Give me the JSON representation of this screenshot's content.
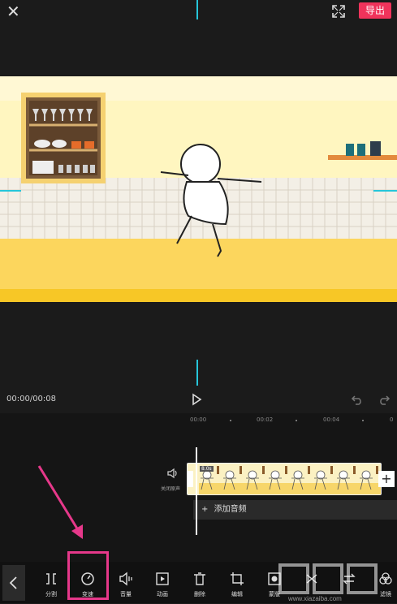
{
  "header": {
    "close_icon": "close-icon",
    "fullscreen_icon": "fullscreen-icon",
    "export_label": "导出"
  },
  "player": {
    "timecode": "00:00/00:08"
  },
  "timeline": {
    "ticks": [
      "00:00",
      "00:02",
      "00:04"
    ],
    "mute_label": "关闭原声",
    "clip_duration": "8.0s",
    "add_clip": "+",
    "add_audio_label": "添加音频"
  },
  "toolbar": {
    "items": [
      {
        "label": "分割",
        "icon": "split-icon"
      },
      {
        "label": "变速",
        "icon": "speed-icon"
      },
      {
        "label": "音量",
        "icon": "volume-icon"
      },
      {
        "label": "动画",
        "icon": "animation-icon"
      },
      {
        "label": "删除",
        "icon": "delete-icon"
      },
      {
        "label": "编辑",
        "icon": "crop-icon"
      },
      {
        "label": "蒙版",
        "icon": "mask-icon"
      },
      {
        "label": "",
        "icon": "replace-icon"
      },
      {
        "label": "",
        "icon": "swap-icon"
      },
      {
        "label": "滤镜",
        "icon": "filter-icon"
      }
    ]
  },
  "annotation": {
    "color": "#e6388a"
  },
  "colors": {
    "accent": "#f0335b",
    "marker": "#26c6da"
  }
}
